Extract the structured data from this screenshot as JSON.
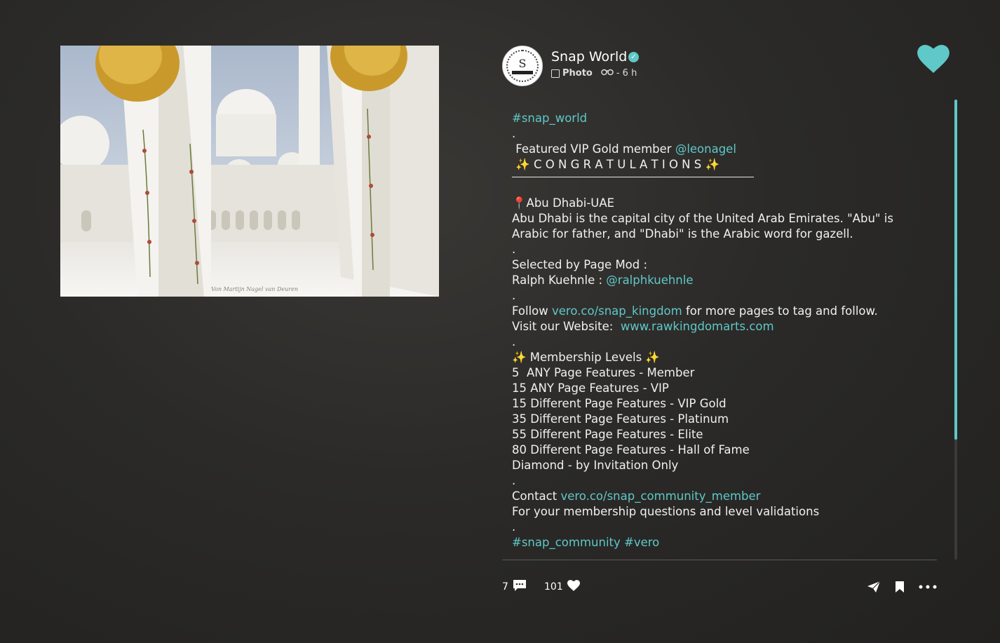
{
  "post": {
    "account_name": "Snap World",
    "verified_icon": "verified-check-icon",
    "avatar_monogram": "S",
    "type_label": "Photo",
    "visibility_icon": "binoculars-icon",
    "time_ago": "- 6 h",
    "photo_credit": "Von Martijn Nagel van Deuren"
  },
  "caption": {
    "l1": "#snap_world",
    "l2": ".",
    "l3_text": " Featured VIP Gold member ",
    "l3_link": "@leonagel",
    "l4": " ✨ C O N G R A T U L A T I O N S ✨",
    "l5": "📍Abu Dhabi-UAE",
    "l6": "Abu Dhabi is the capital city of the United Arab Emirates. \"Abu\" is Arabic for father, and \"Dhabi\" is the Arabic word for gazell.",
    "l7": ".",
    "l8": "Selected by Page Mod :",
    "l9_text": "Ralph Kuehnle : ",
    "l9_link": "@ralphkuehnle",
    "l10": ".",
    "l11_text": "Follow ",
    "l11_link": "vero.co/snap_kingdom",
    "l11_rest": " for more pages to tag and follow.",
    "l12_text": "Visit our Website:  ",
    "l12_link": "www.rawkingdomarts.com",
    "l13": ".",
    "l14": "✨ Membership Levels ✨",
    "levels": [
      "5  ANY Page Features - Member",
      "15 ANY Page Features - VIP",
      "15 Different Page Features - VIP Gold",
      "35 Different Page Features - Platinum",
      "55 Different Page Features - Elite",
      "80 Different Page Features - Hall of Fame",
      "Diamond - by Invitation Only"
    ],
    "l15": ".",
    "l16_text": "Contact ",
    "l16_link": "vero.co/snap_community_member",
    "l17": "For your membership questions and level validations",
    "l18": ".",
    "l19_link": "#snap_community #vero"
  },
  "footer": {
    "comments_count": "7",
    "likes_count": "101"
  },
  "colors": {
    "accent": "#5fc8c8",
    "background": "#2b2a28"
  },
  "icons": {
    "like_top": "heart-icon",
    "comment": "comment-icon",
    "like": "heart-icon",
    "share": "send-icon",
    "bookmark": "bookmark-icon",
    "more": "more-icon"
  },
  "scroll": {
    "position_fraction": 0.0,
    "visible_fraction": 0.74
  }
}
